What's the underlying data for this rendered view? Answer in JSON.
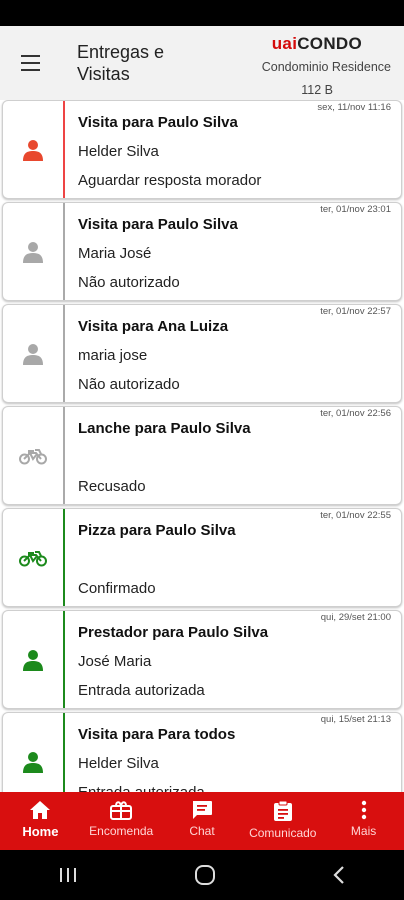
{
  "header": {
    "title": "Entregas e Visitas",
    "brand_prefix": "uai",
    "brand_suffix": "CONDO",
    "condominium": "Condominio Residence",
    "unit": "112 B"
  },
  "items": [
    {
      "timestamp": "sex, 11/nov 11:16",
      "title": "Visita para Paulo Silva",
      "person": "Helder Silva",
      "status": "Aguardar resposta morador",
      "icon": "person-icon",
      "color": "#e8482e"
    },
    {
      "timestamp": "ter, 01/nov 23:01",
      "title": "Visita para Paulo Silva",
      "person": "Maria José",
      "status": "Não autorizado",
      "icon": "person-icon",
      "color": "#a8a8a8"
    },
    {
      "timestamp": "ter, 01/nov 22:57",
      "title": "Visita para Ana Luiza",
      "person": "maria jose",
      "status": "Não autorizado",
      "icon": "person-icon",
      "color": "#a8a8a8"
    },
    {
      "timestamp": "ter, 01/nov 22:56",
      "title": "Lanche para Paulo Silva",
      "person": "",
      "status": "Recusado",
      "icon": "motorcycle-icon",
      "color": "#a8a8a8"
    },
    {
      "timestamp": "ter, 01/nov 22:55",
      "title": "Pizza para Paulo Silva",
      "person": "",
      "status": "Confirmado",
      "icon": "motorcycle-icon",
      "color": "#1c8a1c"
    },
    {
      "timestamp": "qui, 29/set 21:00",
      "title": "Prestador para Paulo Silva",
      "person": "José Maria",
      "status": "Entrada autorizada",
      "icon": "person-icon",
      "color": "#1c8a1c"
    },
    {
      "timestamp": "qui, 15/set 21:13",
      "title": "Visita para Para todos",
      "person": "Helder Silva",
      "status": "Entrada autorizada",
      "icon": "person-icon",
      "color": "#1c8a1c"
    }
  ],
  "bottom_nav": [
    {
      "label": "Home",
      "icon": "home-icon"
    },
    {
      "label": "Encomenda",
      "icon": "package-icon"
    },
    {
      "label": "Chat",
      "icon": "chat-icon"
    },
    {
      "label": "Comunicado",
      "icon": "clipboard-icon"
    },
    {
      "label": "Mais",
      "icon": "more-vertical-icon"
    }
  ],
  "colors": {
    "accent": "#d80f0f",
    "pending": "#e8482e",
    "approved": "#1c8a1c",
    "denied": "#a8a8a8"
  }
}
